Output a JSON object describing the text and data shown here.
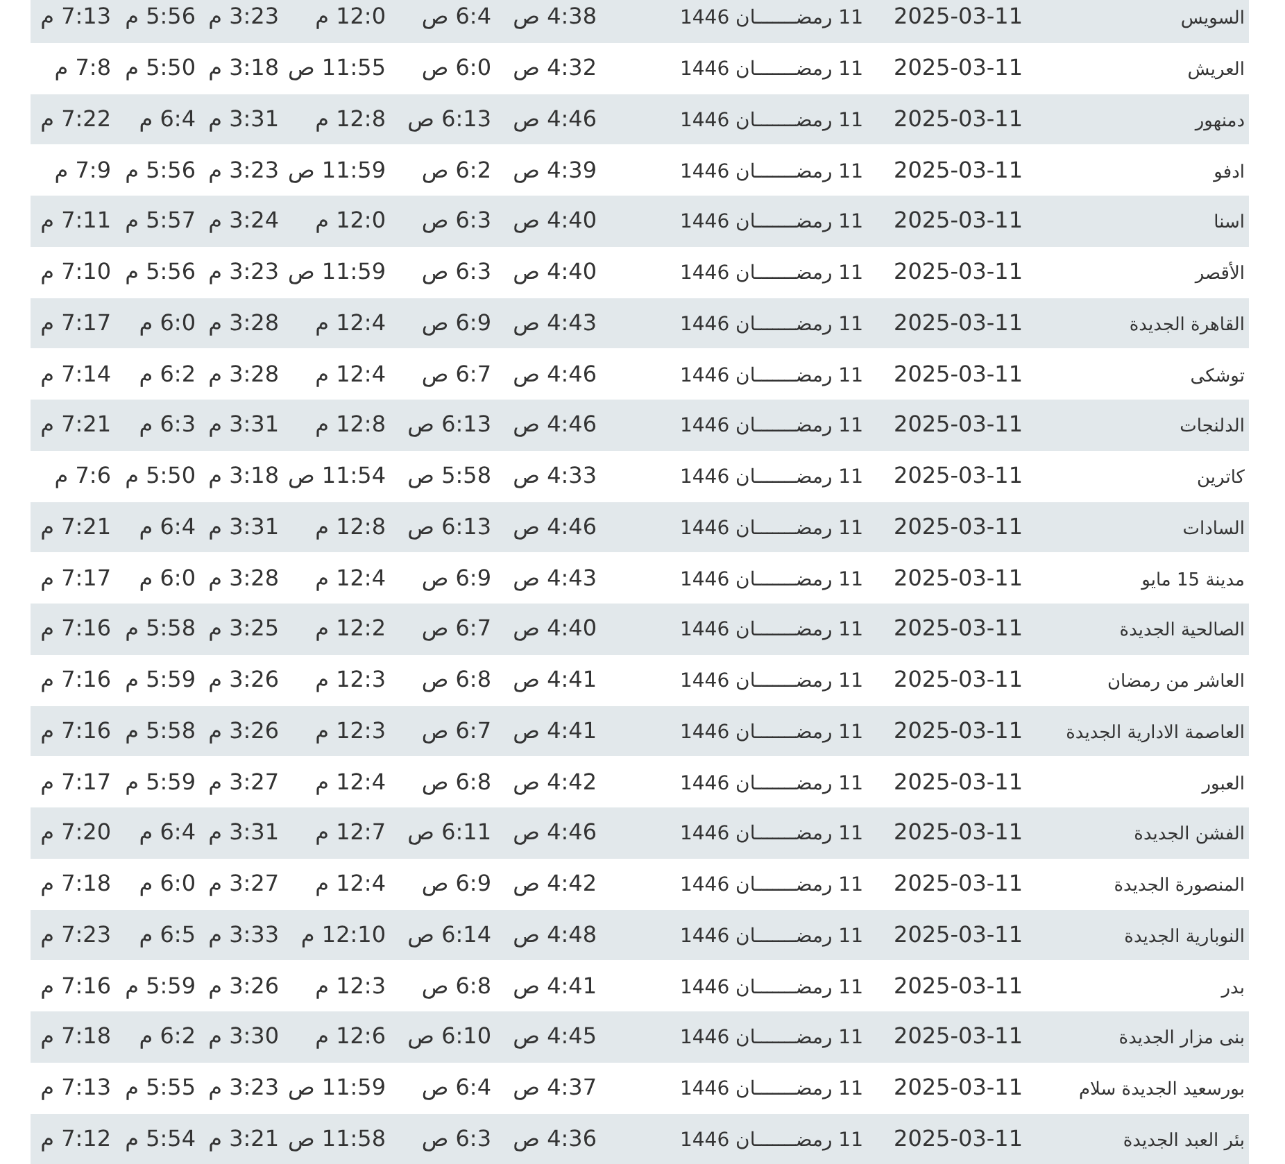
{
  "table": {
    "rows": [
      {
        "cells": [
          "السويس",
          "2025-03-11",
          "11 رمضـــــــان 1446",
          "4:38 ص",
          "6:4 ص",
          "12:0 م",
          "3:23 م",
          "5:56 م",
          "7:13 م"
        ]
      },
      {
        "cells": [
          "العريش",
          "2025-03-11",
          "11 رمضـــــــان 1446",
          "4:32 ص",
          "6:0 ص",
          "11:55 ص",
          "3:18 م",
          "5:50 م",
          "7:8 م"
        ]
      },
      {
        "cells": [
          "دمنهور",
          "2025-03-11",
          "11 رمضـــــــان 1446",
          "4:46 ص",
          "6:13 ص",
          "12:8 م",
          "3:31 م",
          "6:4 م",
          "7:22 م"
        ]
      },
      {
        "cells": [
          "ادفو",
          "2025-03-11",
          "11 رمضـــــــان 1446",
          "4:39 ص",
          "6:2 ص",
          "11:59 ص",
          "3:23 م",
          "5:56 م",
          "7:9 م"
        ]
      },
      {
        "cells": [
          "اسنا",
          "2025-03-11",
          "11 رمضـــــــان 1446",
          "4:40 ص",
          "6:3 ص",
          "12:0 م",
          "3:24 م",
          "5:57 م",
          "7:11 م"
        ]
      },
      {
        "cells": [
          "الأقصر",
          "2025-03-11",
          "11 رمضـــــــان 1446",
          "4:40 ص",
          "6:3 ص",
          "11:59 ص",
          "3:23 م",
          "5:56 م",
          "7:10 م"
        ]
      },
      {
        "cells": [
          "القاهرة الجديدة",
          "2025-03-11",
          "11 رمضـــــــان 1446",
          "4:43 ص",
          "6:9 ص",
          "12:4 م",
          "3:28 م",
          "6:0 م",
          "7:17 م"
        ]
      },
      {
        "cells": [
          "توشكى",
          "2025-03-11",
          "11 رمضـــــــان 1446",
          "4:46 ص",
          "6:7 ص",
          "12:4 م",
          "3:28 م",
          "6:2 م",
          "7:14 م"
        ]
      },
      {
        "cells": [
          "الدلنجات",
          "2025-03-11",
          "11 رمضـــــــان 1446",
          "4:46 ص",
          "6:13 ص",
          "12:8 م",
          "3:31 م",
          "6:3 م",
          "7:21 م"
        ]
      },
      {
        "cells": [
          "كاترين",
          "2025-03-11",
          "11 رمضـــــــان 1446",
          "4:33 ص",
          "5:58 ص",
          "11:54 ص",
          "3:18 م",
          "5:50 م",
          "7:6 م"
        ]
      },
      {
        "cells": [
          "السادات",
          "2025-03-11",
          "11 رمضـــــــان 1446",
          "4:46 ص",
          "6:13 ص",
          "12:8 م",
          "3:31 م",
          "6:4 م",
          "7:21 م"
        ]
      },
      {
        "cells": [
          "مدينة 15 مايو",
          "2025-03-11",
          "11 رمضـــــــان 1446",
          "4:43 ص",
          "6:9 ص",
          "12:4 م",
          "3:28 م",
          "6:0 م",
          "7:17 م"
        ]
      },
      {
        "cells": [
          "الصالحية الجديدة",
          "2025-03-11",
          "11 رمضـــــــان 1446",
          "4:40 ص",
          "6:7 ص",
          "12:2 م",
          "3:25 م",
          "5:58 م",
          "7:16 م"
        ]
      },
      {
        "cells": [
          "العاشر من رمضان",
          "2025-03-11",
          "11 رمضـــــــان 1446",
          "4:41 ص",
          "6:8 ص",
          "12:3 م",
          "3:26 م",
          "5:59 م",
          "7:16 م"
        ]
      },
      {
        "cells": [
          "العاصمة الادارية الجديدة",
          "2025-03-11",
          "11 رمضـــــــان 1446",
          "4:41 ص",
          "6:7 ص",
          "12:3 م",
          "3:26 م",
          "5:58 م",
          "7:16 م"
        ]
      },
      {
        "cells": [
          "العبور",
          "2025-03-11",
          "11 رمضـــــــان 1446",
          "4:42 ص",
          "6:8 ص",
          "12:4 م",
          "3:27 م",
          "5:59 م",
          "7:17 م"
        ]
      },
      {
        "cells": [
          "الفشن الجديدة",
          "2025-03-11",
          "11 رمضـــــــان 1446",
          "4:46 ص",
          "6:11 ص",
          "12:7 م",
          "3:31 م",
          "6:4 م",
          "7:20 م"
        ]
      },
      {
        "cells": [
          "المنصورة الجديدة",
          "2025-03-11",
          "11 رمضـــــــان 1446",
          "4:42 ص",
          "6:9 ص",
          "12:4 م",
          "3:27 م",
          "6:0 م",
          "7:18 م"
        ]
      },
      {
        "cells": [
          "النوبارية الجديدة",
          "2025-03-11",
          "11 رمضـــــــان 1446",
          "4:48 ص",
          "6:14 ص",
          "12:10 م",
          "3:33 م",
          "6:5 م",
          "7:23 م"
        ]
      },
      {
        "cells": [
          "بدر",
          "2025-03-11",
          "11 رمضـــــــان 1446",
          "4:41 ص",
          "6:8 ص",
          "12:3 م",
          "3:26 م",
          "5:59 م",
          "7:16 م"
        ]
      },
      {
        "cells": [
          "بنى مزار الجديدة",
          "2025-03-11",
          "11 رمضـــــــان 1446",
          "4:45 ص",
          "6:10 ص",
          "12:6 م",
          "3:30 م",
          "6:2 م",
          "7:18 م"
        ]
      },
      {
        "cells": [
          "بورسعيد الجديدة سلام",
          "2025-03-11",
          "11 رمضـــــــان 1446",
          "4:37 ص",
          "6:4 ص",
          "11:59 ص",
          "3:23 م",
          "5:55 م",
          "7:13 م"
        ]
      },
      {
        "cells": [
          "بئر العبد الجديدة",
          "2025-03-11",
          "11 رمضـــــــان 1446",
          "4:36 ص",
          "6:3 ص",
          "11:58 ص",
          "3:21 م",
          "5:54 م",
          "7:12 م"
        ]
      }
    ]
  }
}
